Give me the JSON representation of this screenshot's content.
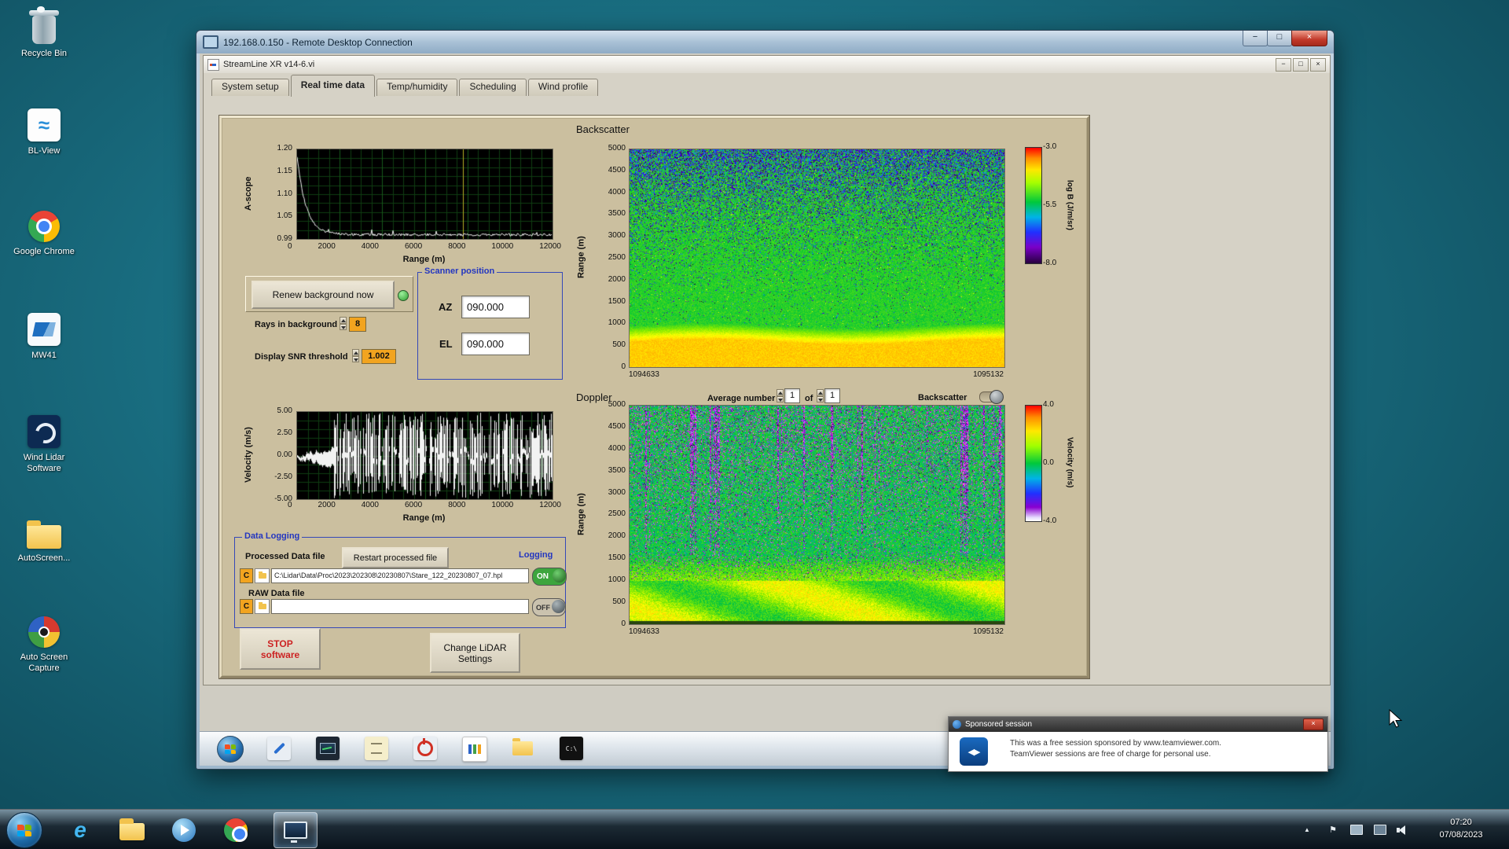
{
  "colors": {
    "panel-tan": "#cbbf9f",
    "accent-orange": "#f2a41f",
    "led-green": "#2f9e2f",
    "toggle-green": "#3da53d",
    "blue-label": "#2336c0"
  },
  "glyphs": {
    "minimize": "−",
    "maximize": "□",
    "close": "×",
    "tv_logo": "◀▶",
    "tray_chevron": "▲",
    "tray_flag": "⚑",
    "ie": "e",
    "wave": "≈",
    "cmd": "C:\\"
  },
  "desktop": {
    "icons": [
      {
        "label": "Recycle Bin"
      },
      {
        "label": "BL-View"
      },
      {
        "label": "Google Chrome"
      },
      {
        "label": "MW41"
      },
      {
        "label": "Wind Lidar Software"
      },
      {
        "label": "AutoScreen..."
      },
      {
        "label": "Auto Screen Capture"
      }
    ]
  },
  "rdp": {
    "title": "192.168.0.150 - Remote Desktop Connection"
  },
  "app": {
    "title": "StreamLine XR v14-6.vi",
    "tabs": [
      "System setup",
      "Real time data",
      "Temp/humidity",
      "Scheduling",
      "Wind profile"
    ]
  },
  "ascope": {
    "ylabel": "A-scope",
    "xlabel": "Range (m)",
    "yticks": [
      "1.20",
      "1.15",
      "1.10",
      "1.05",
      "0.99"
    ],
    "xticks": [
      "0",
      "2000",
      "4000",
      "6000",
      "8000",
      "10000",
      "12000"
    ]
  },
  "background_ctrl": {
    "renew": "Renew background now",
    "rays_label": "Rays in background",
    "rays_value": "8",
    "snr_label": "Display SNR threshold",
    "snr_value": "1.002"
  },
  "scanner": {
    "title": "Scanner position",
    "az_label": "AZ",
    "az_value": "090.000",
    "el_label": "EL",
    "el_value": "090.000"
  },
  "backscatter": {
    "title": "Backscatter",
    "ylabel": "Range (m)",
    "yticks": [
      "5000",
      "4500",
      "4000",
      "3500",
      "3000",
      "2500",
      "2000",
      "1500",
      "1000",
      "500",
      "0"
    ],
    "x_start": "1094633",
    "x_end": "1095132",
    "cbar_label": "log B (J/m/sr)",
    "cbar_ticks": [
      "-3.0",
      "-5.5",
      "-8.0"
    ]
  },
  "doppler": {
    "title": "Doppler",
    "avg_label": "Average number",
    "avg_value": "1",
    "of_label": "of",
    "of_value": "1",
    "toggle_label": "Backscatter",
    "ylabel": "Range (m)",
    "yticks": [
      "5000",
      "4500",
      "4000",
      "3500",
      "3000",
      "2500",
      "2000",
      "1500",
      "1000",
      "500",
      "0"
    ],
    "x_start": "1094633",
    "x_end": "1095132",
    "cbar_label": "Velocity (m/s)",
    "cbar_ticks": [
      "4.0",
      "0.0",
      "-4.0"
    ]
  },
  "velocity": {
    "ylabel": "Velocity (m/s)",
    "xlabel": "Range (m)",
    "yticks": [
      "5.00",
      "2.50",
      "0.00",
      "-2.50",
      "-5.00"
    ],
    "xticks": [
      "0",
      "2000",
      "4000",
      "6000",
      "8000",
      "10000",
      "12000"
    ]
  },
  "logging": {
    "title": "Data Logging",
    "processed_label": "Processed Data file",
    "restart_button": "Restart processed file",
    "logging_label": "Logging",
    "drive": "C",
    "processed_path": "C:\\Lidar\\Data\\Proc\\2023\\202308\\20230807\\Stare_122_20230807_07.hpl",
    "raw_label": "RAW Data file",
    "raw_path": "",
    "on": "ON",
    "off": "OFF"
  },
  "actions": {
    "stop_line1": "STOP",
    "stop_line2": "software",
    "change_line1": "Change LiDAR",
    "change_line2": "Settings"
  },
  "teamviewer": {
    "title": "Sponsored session",
    "line1": "This was a free session sponsored by www.teamviewer.com.",
    "line2": "TeamViewer sessions are free of charge for personal use."
  },
  "taskbar": {
    "time": "07:20",
    "date": "07/08/2023"
  }
}
